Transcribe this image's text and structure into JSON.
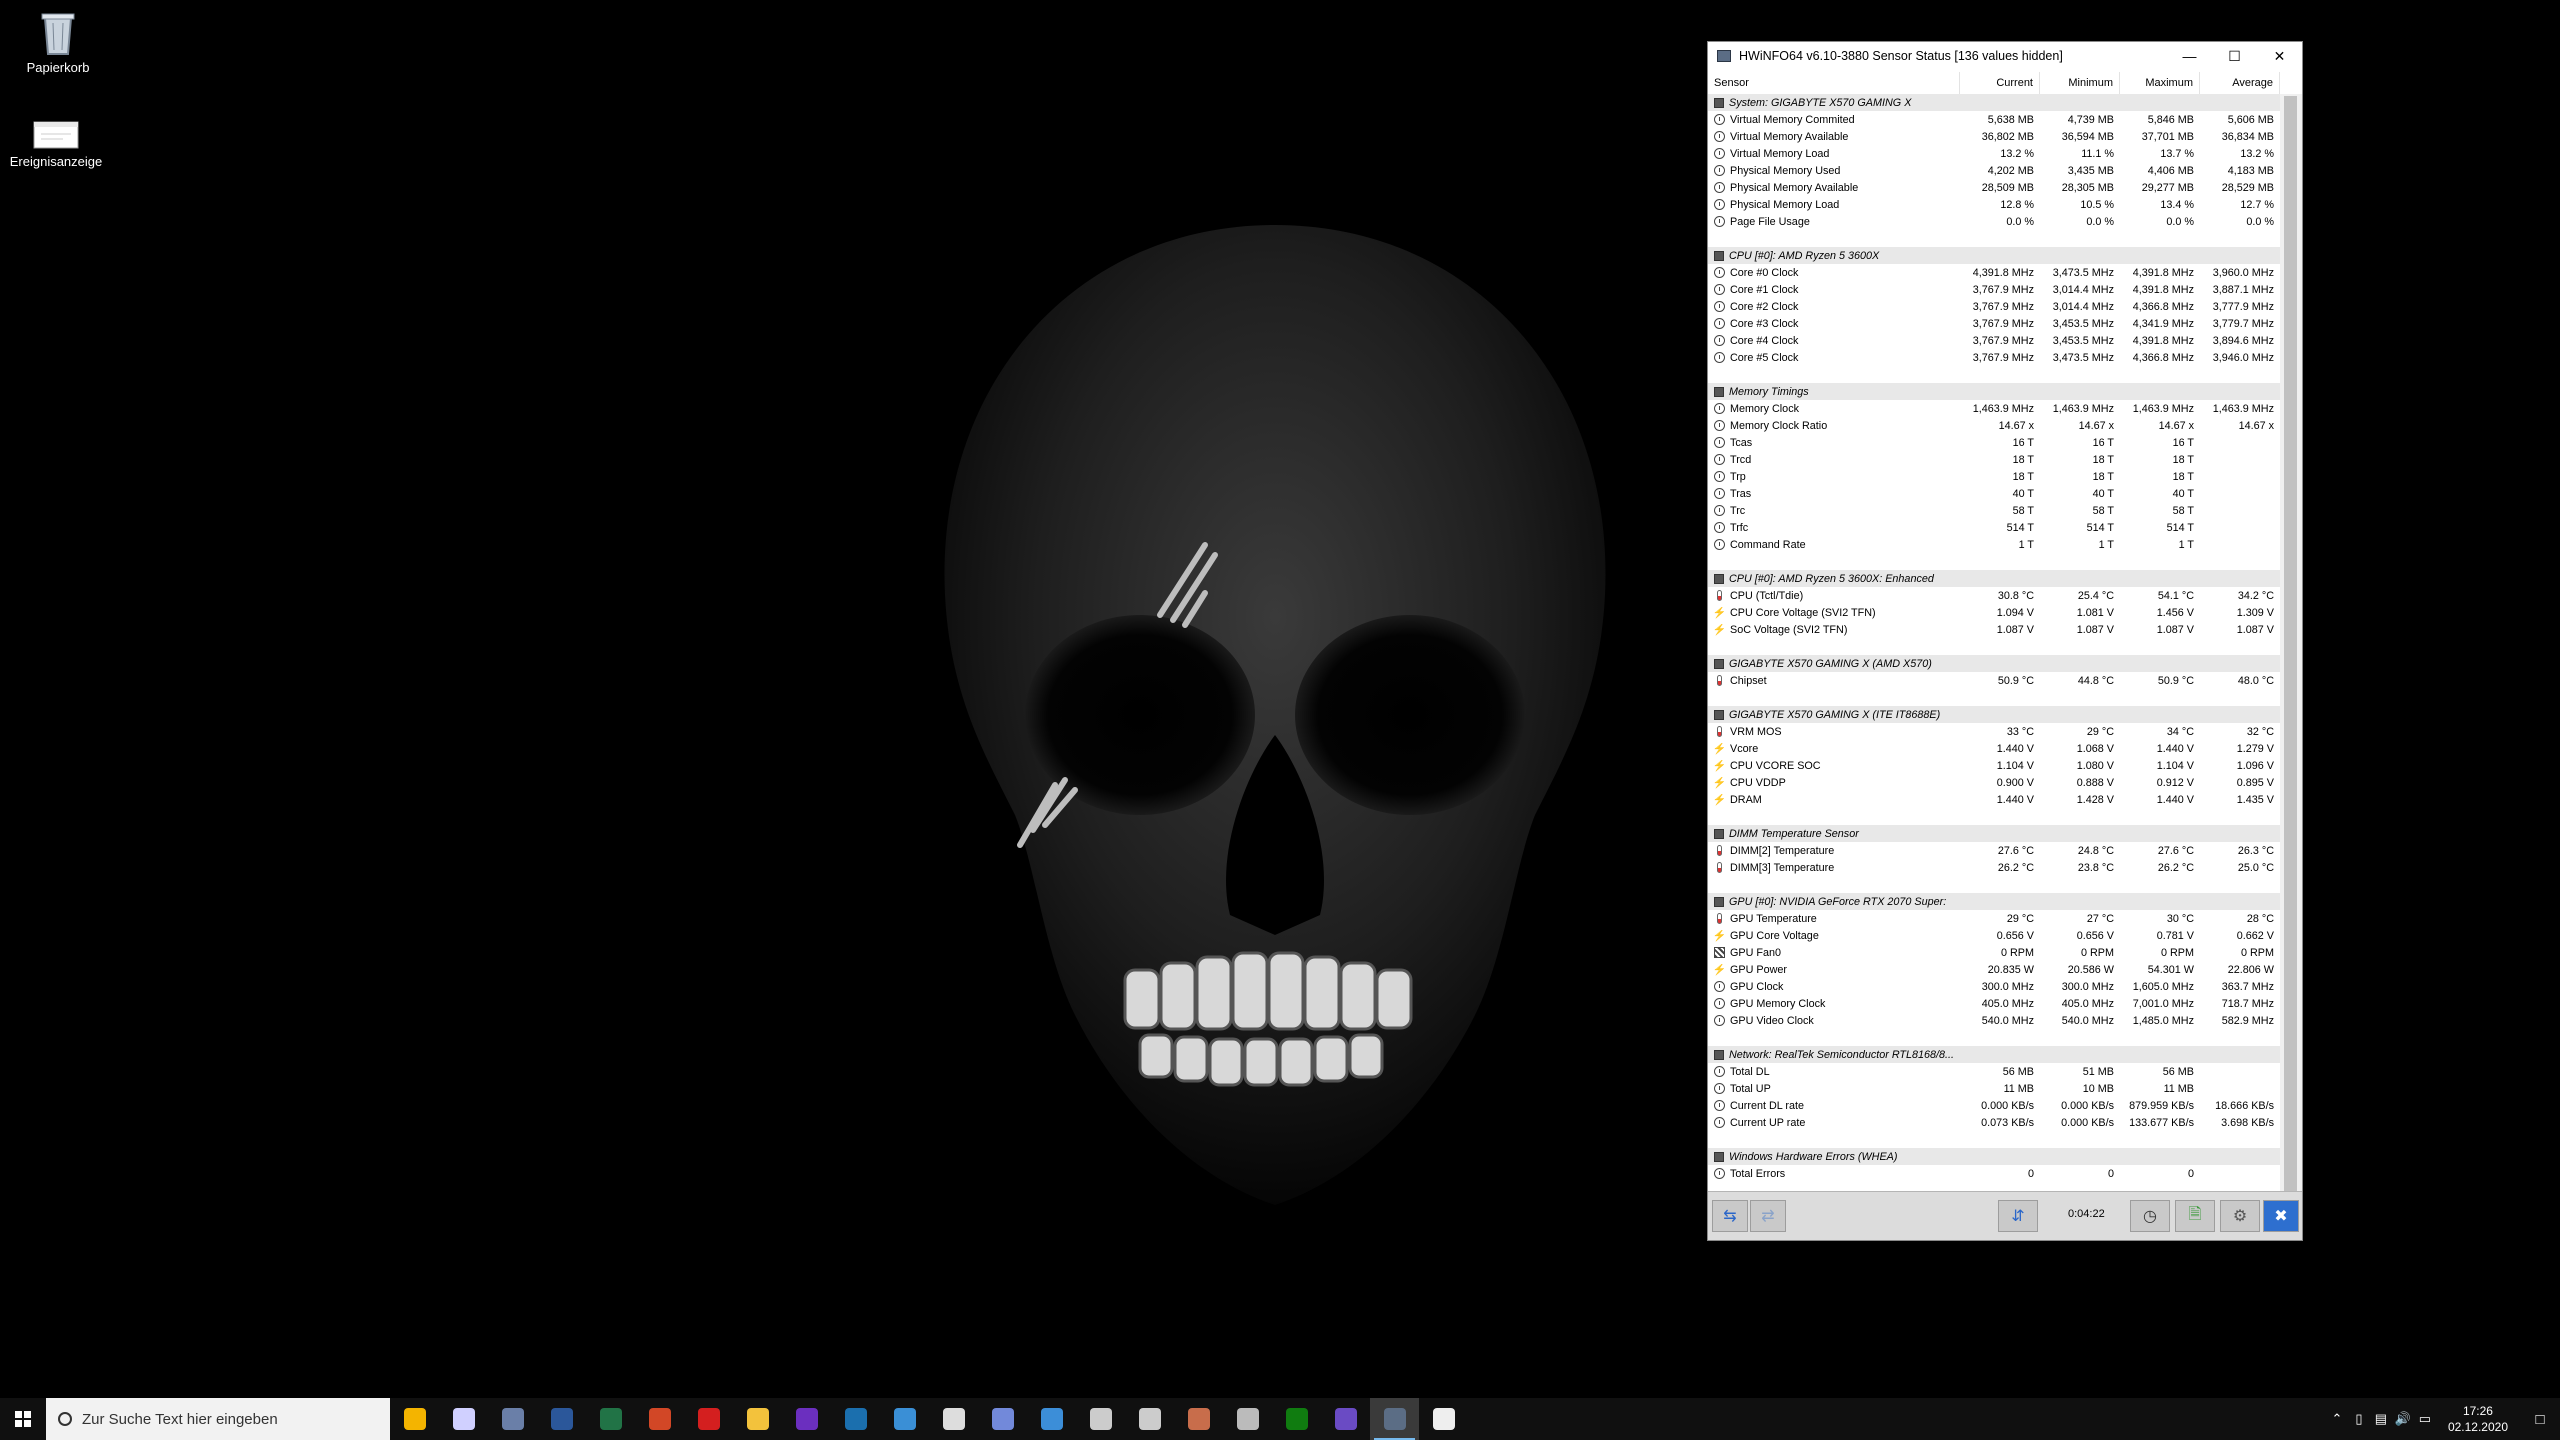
{
  "desktop": {
    "icons": [
      {
        "label": "Papierkorb",
        "icon": "recycle-bin-icon"
      },
      {
        "label": "Ereignisanzeige",
        "icon": "event-viewer-icon"
      }
    ]
  },
  "window": {
    "title": "HWiNFO64 v6.10-3880 Sensor Status [136 values hidden]",
    "controls": {
      "minimize": "—",
      "maximize": "☐",
      "close": "✕"
    },
    "columns": [
      "Sensor",
      "Current",
      "Minimum",
      "Maximum",
      "Average"
    ],
    "groups": [
      {
        "title": "System: GIGABYTE X570 GAMING X",
        "rows": [
          {
            "icon": "clock",
            "name": "Virtual Memory Commited",
            "cur": "5,638 MB",
            "min": "4,739 MB",
            "max": "5,846 MB",
            "avg": "5,606 MB"
          },
          {
            "icon": "clock",
            "name": "Virtual Memory Available",
            "cur": "36,802 MB",
            "min": "36,594 MB",
            "max": "37,701 MB",
            "avg": "36,834 MB"
          },
          {
            "icon": "clock",
            "name": "Virtual Memory Load",
            "cur": "13.2 %",
            "min": "11.1 %",
            "max": "13.7 %",
            "avg": "13.2 %"
          },
          {
            "icon": "clock",
            "name": "Physical Memory Used",
            "cur": "4,202 MB",
            "min": "3,435 MB",
            "max": "4,406 MB",
            "avg": "4,183 MB"
          },
          {
            "icon": "clock",
            "name": "Physical Memory Available",
            "cur": "28,509 MB",
            "min": "28,305 MB",
            "max": "29,277 MB",
            "avg": "28,529 MB"
          },
          {
            "icon": "clock",
            "name": "Physical Memory Load",
            "cur": "12.8 %",
            "min": "10.5 %",
            "max": "13.4 %",
            "avg": "12.7 %"
          },
          {
            "icon": "clock",
            "name": "Page File Usage",
            "cur": "0.0 %",
            "min": "0.0 %",
            "max": "0.0 %",
            "avg": "0.0 %"
          }
        ]
      },
      {
        "title": "CPU [#0]: AMD Ryzen 5 3600X",
        "rows": [
          {
            "icon": "clock",
            "name": "Core #0 Clock",
            "cur": "4,391.8 MHz",
            "min": "3,473.5 MHz",
            "max": "4,391.8 MHz",
            "avg": "3,960.0 MHz"
          },
          {
            "icon": "clock",
            "name": "Core #1 Clock",
            "cur": "3,767.9 MHz",
            "min": "3,014.4 MHz",
            "max": "4,391.8 MHz",
            "avg": "3,887.1 MHz"
          },
          {
            "icon": "clock",
            "name": "Core #2 Clock",
            "cur": "3,767.9 MHz",
            "min": "3,014.4 MHz",
            "max": "4,366.8 MHz",
            "avg": "3,777.9 MHz"
          },
          {
            "icon": "clock",
            "name": "Core #3 Clock",
            "cur": "3,767.9 MHz",
            "min": "3,453.5 MHz",
            "max": "4,341.9 MHz",
            "avg": "3,779.7 MHz"
          },
          {
            "icon": "clock",
            "name": "Core #4 Clock",
            "cur": "3,767.9 MHz",
            "min": "3,453.5 MHz",
            "max": "4,391.8 MHz",
            "avg": "3,894.6 MHz"
          },
          {
            "icon": "clock",
            "name": "Core #5 Clock",
            "cur": "3,767.9 MHz",
            "min": "3,473.5 MHz",
            "max": "4,366.8 MHz",
            "avg": "3,946.0 MHz"
          }
        ]
      },
      {
        "title": "Memory Timings",
        "rows": [
          {
            "icon": "clock",
            "name": "Memory Clock",
            "cur": "1,463.9 MHz",
            "min": "1,463.9 MHz",
            "max": "1,463.9 MHz",
            "avg": "1,463.9 MHz"
          },
          {
            "icon": "clock",
            "name": "Memory Clock Ratio",
            "cur": "14.67 x",
            "min": "14.67 x",
            "max": "14.67 x",
            "avg": "14.67 x"
          },
          {
            "icon": "clock",
            "name": "Tcas",
            "cur": "16 T",
            "min": "16 T",
            "max": "16 T",
            "avg": ""
          },
          {
            "icon": "clock",
            "name": "Trcd",
            "cur": "18 T",
            "min": "18 T",
            "max": "18 T",
            "avg": ""
          },
          {
            "icon": "clock",
            "name": "Trp",
            "cur": "18 T",
            "min": "18 T",
            "max": "18 T",
            "avg": ""
          },
          {
            "icon": "clock",
            "name": "Tras",
            "cur": "40 T",
            "min": "40 T",
            "max": "40 T",
            "avg": ""
          },
          {
            "icon": "clock",
            "name": "Trc",
            "cur": "58 T",
            "min": "58 T",
            "max": "58 T",
            "avg": ""
          },
          {
            "icon": "clock",
            "name": "Trfc",
            "cur": "514 T",
            "min": "514 T",
            "max": "514 T",
            "avg": ""
          },
          {
            "icon": "clock",
            "name": "Command Rate",
            "cur": "1 T",
            "min": "1 T",
            "max": "1 T",
            "avg": ""
          }
        ]
      },
      {
        "title": "CPU [#0]: AMD Ryzen 5 3600X: Enhanced",
        "rows": [
          {
            "icon": "temp",
            "name": "CPU (Tctl/Tdie)",
            "cur": "30.8 °C",
            "min": "25.4 °C",
            "max": "54.1 °C",
            "avg": "34.2 °C"
          },
          {
            "icon": "volt",
            "name": "CPU Core Voltage (SVI2 TFN)",
            "cur": "1.094 V",
            "min": "1.081 V",
            "max": "1.456 V",
            "avg": "1.309 V"
          },
          {
            "icon": "volt",
            "name": "SoC Voltage (SVI2 TFN)",
            "cur": "1.087 V",
            "min": "1.087 V",
            "max": "1.087 V",
            "avg": "1.087 V"
          }
        ]
      },
      {
        "title": "GIGABYTE X570 GAMING X (AMD X570)",
        "rows": [
          {
            "icon": "temp",
            "name": "Chipset",
            "cur": "50.9 °C",
            "min": "44.8 °C",
            "max": "50.9 °C",
            "avg": "48.0 °C"
          }
        ]
      },
      {
        "title": "GIGABYTE X570 GAMING X (ITE IT8688E)",
        "rows": [
          {
            "icon": "temp",
            "name": "VRM MOS",
            "cur": "33 °C",
            "min": "29 °C",
            "max": "34 °C",
            "avg": "32 °C"
          },
          {
            "icon": "volt",
            "name": "Vcore",
            "cur": "1.440 V",
            "min": "1.068 V",
            "max": "1.440 V",
            "avg": "1.279 V"
          },
          {
            "icon": "volt",
            "name": "CPU VCORE SOC",
            "cur": "1.104 V",
            "min": "1.080 V",
            "max": "1.104 V",
            "avg": "1.096 V"
          },
          {
            "icon": "volt",
            "name": "CPU VDDP",
            "cur": "0.900 V",
            "min": "0.888 V",
            "max": "0.912 V",
            "avg": "0.895 V"
          },
          {
            "icon": "volt",
            "name": "DRAM",
            "cur": "1.440 V",
            "min": "1.428 V",
            "max": "1.440 V",
            "avg": "1.435 V"
          }
        ]
      },
      {
        "title": "DIMM Temperature Sensor",
        "rows": [
          {
            "icon": "temp",
            "name": "DIMM[2] Temperature",
            "cur": "27.6 °C",
            "min": "24.8 °C",
            "max": "27.6 °C",
            "avg": "26.3 °C"
          },
          {
            "icon": "temp",
            "name": "DIMM[3] Temperature",
            "cur": "26.2 °C",
            "min": "23.8 °C",
            "max": "26.2 °C",
            "avg": "25.0 °C"
          }
        ]
      },
      {
        "title": "GPU [#0]: NVIDIA GeForce RTX 2070 Super:",
        "rows": [
          {
            "icon": "temp",
            "name": "GPU Temperature",
            "cur": "29 °C",
            "min": "27 °C",
            "max": "30 °C",
            "avg": "28 °C"
          },
          {
            "icon": "volt",
            "name": "GPU Core Voltage",
            "cur": "0.656 V",
            "min": "0.656 V",
            "max": "0.781 V",
            "avg": "0.662 V"
          },
          {
            "icon": "fan",
            "name": "GPU Fan0",
            "cur": "0 RPM",
            "min": "0 RPM",
            "max": "0 RPM",
            "avg": "0 RPM"
          },
          {
            "icon": "power",
            "name": "GPU Power",
            "cur": "20.835 W",
            "min": "20.586 W",
            "max": "54.301 W",
            "avg": "22.806 W"
          },
          {
            "icon": "clock",
            "name": "GPU Clock",
            "cur": "300.0 MHz",
            "min": "300.0 MHz",
            "max": "1,605.0 MHz",
            "avg": "363.7 MHz"
          },
          {
            "icon": "clock",
            "name": "GPU Memory Clock",
            "cur": "405.0 MHz",
            "min": "405.0 MHz",
            "max": "7,001.0 MHz",
            "avg": "718.7 MHz"
          },
          {
            "icon": "clock",
            "name": "GPU Video Clock",
            "cur": "540.0 MHz",
            "min": "540.0 MHz",
            "max": "1,485.0 MHz",
            "avg": "582.9 MHz"
          }
        ]
      },
      {
        "title": "Network: RealTek Semiconductor RTL8168/8...",
        "rows": [
          {
            "icon": "clock",
            "name": "Total DL",
            "cur": "56 MB",
            "min": "51 MB",
            "max": "56 MB",
            "avg": ""
          },
          {
            "icon": "clock",
            "name": "Total UP",
            "cur": "11 MB",
            "min": "10 MB",
            "max": "11 MB",
            "avg": ""
          },
          {
            "icon": "clock",
            "name": "Current DL rate",
            "cur": "0.000 KB/s",
            "min": "0.000 KB/s",
            "max": "879.959 KB/s",
            "avg": "18.666 KB/s"
          },
          {
            "icon": "clock",
            "name": "Current UP rate",
            "cur": "0.073 KB/s",
            "min": "0.000 KB/s",
            "max": "133.677 KB/s",
            "avg": "3.698 KB/s"
          }
        ]
      },
      {
        "title": "Windows Hardware Errors (WHEA)",
        "rows": [
          {
            "icon": "clock",
            "name": "Total Errors",
            "cur": "0",
            "min": "0",
            "max": "0",
            "avg": ""
          }
        ]
      }
    ],
    "bottom": {
      "elapsed": "0:04:22"
    }
  },
  "taskbar": {
    "search_placeholder": "Zur Suche Text hier eingeben",
    "apps": [
      {
        "icon": "chrome-icon",
        "color": "#f4b400"
      },
      {
        "icon": "itunes-icon",
        "color": "#d0d0ff"
      },
      {
        "icon": "calculator-icon",
        "color": "#6a7fa8"
      },
      {
        "icon": "word-icon",
        "color": "#2b579a"
      },
      {
        "icon": "excel-icon",
        "color": "#217346"
      },
      {
        "icon": "powerpoint-icon",
        "color": "#d24726"
      },
      {
        "icon": "acrobat-icon",
        "color": "#d41f1f"
      },
      {
        "icon": "file-explorer-icon",
        "color": "#f3c23c"
      },
      {
        "icon": "edge-icon",
        "color": "#6b2fbf"
      },
      {
        "icon": "steam-icon",
        "color": "#1b6fae"
      },
      {
        "icon": "unknown-app-icon",
        "color": "#3a8fd6"
      },
      {
        "icon": "epic-games-icon",
        "color": "#dddddd"
      },
      {
        "icon": "discord-icon",
        "color": "#7289da"
      },
      {
        "icon": "uplay-icon",
        "color": "#3c8ed8"
      },
      {
        "icon": "settings-icon",
        "color": "#cccccc"
      },
      {
        "icon": "arrow-app-icon",
        "color": "#cccccc"
      },
      {
        "icon": "colorful-app-icon",
        "color": "#c86d4b"
      },
      {
        "icon": "pen-app-icon",
        "color": "#bbbbbb"
      },
      {
        "icon": "xbox-icon",
        "color": "#107c10"
      },
      {
        "icon": "purple-app-icon",
        "color": "#6a4bc4"
      },
      {
        "icon": "hwinfo-icon",
        "color": "#5b6d85",
        "active": true
      },
      {
        "icon": "notes-app-icon",
        "color": "#eeeeee"
      }
    ],
    "time": "17:26",
    "date": "02.12.2020"
  }
}
